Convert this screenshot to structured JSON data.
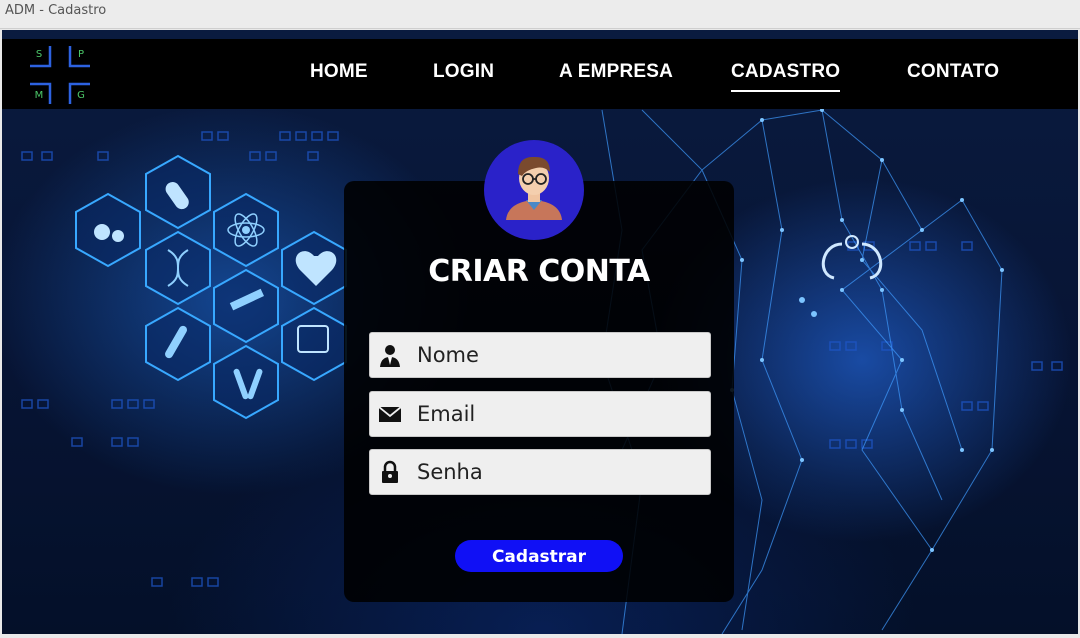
{
  "window": {
    "title": "ADM - Cadastro"
  },
  "logo": {
    "letters": [
      "S",
      "P",
      "M",
      "G"
    ]
  },
  "nav": {
    "items": [
      {
        "label": "HOME",
        "active": false
      },
      {
        "label": "LOGIN",
        "active": false
      },
      {
        "label": "A EMPRESA",
        "active": false
      },
      {
        "label": "CADASTRO",
        "active": true
      },
      {
        "label": "CONTATO",
        "active": false
      }
    ]
  },
  "form": {
    "title": "CRIAR CONTA",
    "fields": [
      {
        "placeholder": "Nome",
        "value": "",
        "icon": "user-icon"
      },
      {
        "placeholder": "Email",
        "value": "",
        "icon": "envelope-icon"
      },
      {
        "placeholder": "Senha",
        "value": "",
        "icon": "lock-icon"
      }
    ],
    "submit_label": "Cadastrar"
  },
  "colors": {
    "navbar": "#000000",
    "button": "#1010f5",
    "avatar_bg": "#2a22c9",
    "logo_letters": "#4cc96a",
    "background": "#071434"
  }
}
